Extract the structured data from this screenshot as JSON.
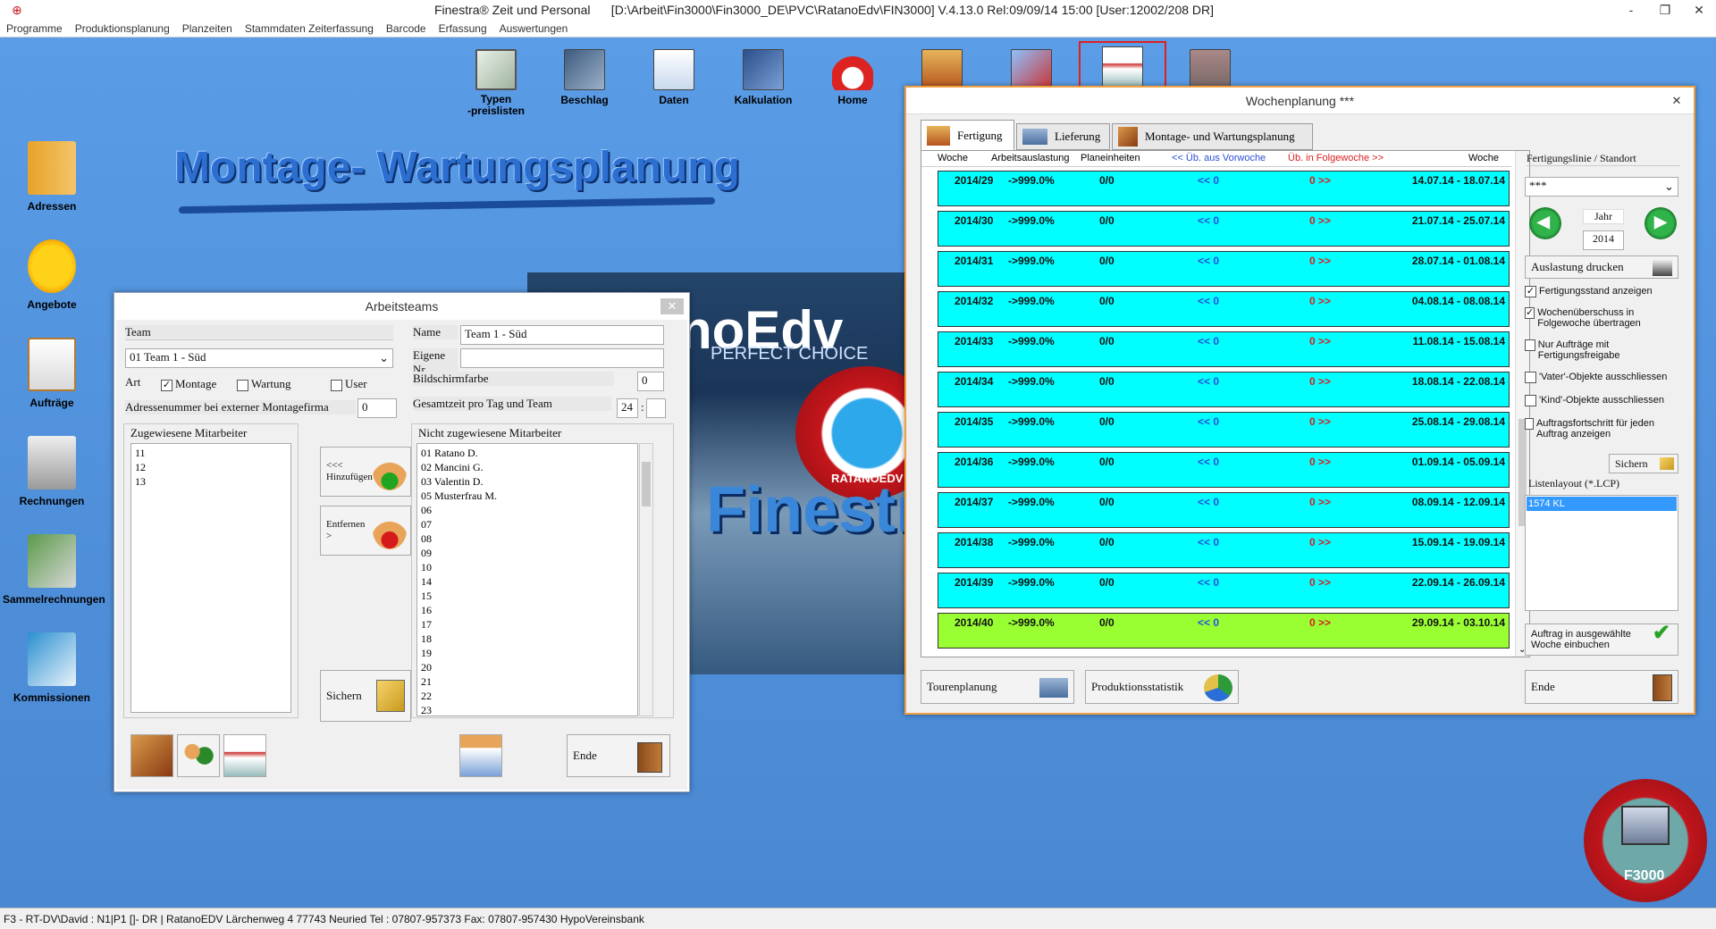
{
  "app": {
    "title": "Finestra® Zeit und Personal      [D:\\Arbeit\\Fin3000\\Fin3000_DE\\PVC\\RatanoEdv\\FIN3000] V.4.13.0 Rel:09/09/14 15:00 [User:12002/208 DR]",
    "window_controls": [
      "-",
      "❐",
      "✕"
    ]
  },
  "menu": [
    "Programme",
    "Produktionsplanung",
    "Planzeiten",
    "Stammdaten Zeiterfassung",
    "Barcode",
    "Erfassung",
    "Auswertungen"
  ],
  "toolbar": [
    {
      "label": "Typen\n-preislisten",
      "icon": "window-frame-icon"
    },
    {
      "label": "Beschlag",
      "icon": "fitting-icon"
    },
    {
      "label": "Daten",
      "icon": "data-icon"
    },
    {
      "label": "Kalkulation",
      "icon": "calculator-icon"
    },
    {
      "label": "Home",
      "icon": "home-icon"
    },
    {
      "label": "",
      "icon": "production-icon"
    },
    {
      "label": "",
      "icon": "chart-icon"
    },
    {
      "label": "",
      "icon": "planning-icon"
    },
    {
      "label": "",
      "icon": "factory-icon"
    }
  ],
  "left_icons": [
    {
      "label": "Adressen",
      "icon": "address-book-icon"
    },
    {
      "label": "Angebote",
      "icon": "sun-icon"
    },
    {
      "label": "Aufträge",
      "icon": "clipboard-icon"
    },
    {
      "label": "Rechnungen",
      "icon": "invoice-calculator-icon"
    },
    {
      "label": "Sammelrechnungen",
      "icon": "money-icon"
    },
    {
      "label": "Kommissionen",
      "icon": "document-arrow-icon"
    }
  ],
  "banner": "Montage- Wartungsplanung",
  "splash": {
    "logo": "noEdv",
    "tagline": "PERFECT CHOICE",
    "product": "Finestra",
    "seal": "RATANOEDV"
  },
  "arbeitsteams": {
    "title": "Arbeitsteams",
    "team_label": "Team",
    "team_value": "01 Team 1 - Süd",
    "name_label": "Name",
    "name_value": "Team 1 - Süd",
    "eigene_label": "Eigene Nr.",
    "eigene_value": "",
    "art_label": "Art",
    "art_options": [
      {
        "label": "Montage",
        "checked": true
      },
      {
        "label": "Wartung",
        "checked": false
      },
      {
        "label": "User",
        "checked": false
      }
    ],
    "farbe_label": "Bildschirmfarbe",
    "farbe_value": "0",
    "adressnr_label": "Adressenummer bei externer Montagefirma",
    "adressnr_value": "0",
    "gesamtzeit_label": "Gesamtzeit pro Tag und Team",
    "gesamtzeit_value": "24",
    "gesamtzeit_sep": ":",
    "gesamtzeit_min": "",
    "zugewiesen_label": "Zugewiesene Mitarbeiter",
    "zugewiesen": [
      "11",
      "12",
      "13"
    ],
    "nicht_label": "Nicht zugewiesene Mitarbeiter",
    "nicht": [
      "01 Ratano D.",
      "02 Mancini G.",
      "03 Valentin D.",
      "05 Musterfrau M.",
      "06",
      "07",
      "08",
      "09",
      "10",
      "14",
      "15",
      "16",
      "17",
      "18",
      "19",
      "20",
      "21",
      "22",
      "23"
    ],
    "hinzufuegen": "<<<\nHinzufügen",
    "entfernen": "Entfernen\n>",
    "sichern": "Sichern",
    "ende": "Ende"
  },
  "wochenplanung": {
    "title": "Wochenplanung ***",
    "tabs": [
      "Fertigung",
      "Lieferung",
      "Montage- und Wartungsplanung"
    ],
    "headers": [
      "Woche",
      "Arbeitsauslastung",
      "Planeinheiten",
      "<< Üb. aus Vorwoche",
      "Üb. in Folgewoche >>",
      "Woche"
    ],
    "rows": [
      {
        "woche": "2014/29",
        "auslastung": "->999.0%",
        "plan": "0/0",
        "vor": "<< 0",
        "folge": "0 >>",
        "range": "14.07.14 - 18.07.14",
        "color": "#00ffff"
      },
      {
        "woche": "2014/30",
        "auslastung": "->999.0%",
        "plan": "0/0",
        "vor": "<< 0",
        "folge": "0 >>",
        "range": "21.07.14 - 25.07.14",
        "color": "#00ffff"
      },
      {
        "woche": "2014/31",
        "auslastung": "->999.0%",
        "plan": "0/0",
        "vor": "<< 0",
        "folge": "0 >>",
        "range": "28.07.14 - 01.08.14",
        "color": "#00ffff"
      },
      {
        "woche": "2014/32",
        "auslastung": "->999.0%",
        "plan": "0/0",
        "vor": "<< 0",
        "folge": "0 >>",
        "range": "04.08.14 - 08.08.14",
        "color": "#00ffff"
      },
      {
        "woche": "2014/33",
        "auslastung": "->999.0%",
        "plan": "0/0",
        "vor": "<< 0",
        "folge": "0 >>",
        "range": "11.08.14 - 15.08.14",
        "color": "#00ffff"
      },
      {
        "woche": "2014/34",
        "auslastung": "->999.0%",
        "plan": "0/0",
        "vor": "<< 0",
        "folge": "0 >>",
        "range": "18.08.14 - 22.08.14",
        "color": "#00ffff"
      },
      {
        "woche": "2014/35",
        "auslastung": "->999.0%",
        "plan": "0/0",
        "vor": "<< 0",
        "folge": "0 >>",
        "range": "25.08.14 - 29.08.14",
        "color": "#00ffff"
      },
      {
        "woche": "2014/36",
        "auslastung": "->999.0%",
        "plan": "0/0",
        "vor": "<< 0",
        "folge": "0 >>",
        "range": "01.09.14 - 05.09.14",
        "color": "#00ffff"
      },
      {
        "woche": "2014/37",
        "auslastung": "->999.0%",
        "plan": "0/0",
        "vor": "<< 0",
        "folge": "0 >>",
        "range": "08.09.14 - 12.09.14",
        "color": "#00ffff"
      },
      {
        "woche": "2014/38",
        "auslastung": "->999.0%",
        "plan": "0/0",
        "vor": "<< 0",
        "folge": "0 >>",
        "range": "15.09.14 - 19.09.14",
        "color": "#00ffff"
      },
      {
        "woche": "2014/39",
        "auslastung": "->999.0%",
        "plan": "0/0",
        "vor": "<< 0",
        "folge": "0 >>",
        "range": "22.09.14 - 26.09.14",
        "color": "#00ffff"
      },
      {
        "woche": "2014/40",
        "auslastung": "->999.0%",
        "plan": "0/0",
        "vor": "<< 0",
        "folge": "0 >>",
        "range": "29.09.14 - 03.10.14",
        "color": "#99ff33"
      }
    ],
    "fertigungslinie_label": "Fertigungslinie / Standort",
    "fertigungslinie_value": "***",
    "jahr_label": "Jahr",
    "jahr_value": "2014",
    "auslastung_drucken": "Auslastung drucken",
    "checks": [
      {
        "label": "Fertigungsstand anzeigen",
        "checked": true
      },
      {
        "label": "Wochenüberschuss in Folgewoche übertragen",
        "checked": true
      },
      {
        "label": "Nur Aufträge mit Fertigungsfreigabe",
        "checked": false
      },
      {
        "label": "'Vater'-Objekte ausschliessen",
        "checked": false
      },
      {
        "label": "'Kind'-Objekte ausschliessen",
        "checked": false
      },
      {
        "label": "Auftragsfortschritt für jeden Auftrag anzeigen",
        "checked": false
      }
    ],
    "sichern": "Sichern",
    "listenlayout_label": "Listenlayout (*.LCP)",
    "listenlayout_value": "1574 KL",
    "einbuchen": "Auftrag in ausgewählte Woche einbuchen",
    "tourenplanung": "Tourenplanung",
    "produktionsstatistik": "Produktionsstatistik",
    "ende": "Ende"
  },
  "status": "F3 - RT-DV\\David : N1|P1 []- DR | RatanoEDV Lärchenweg 4  77743 Neuried  Tel : 07807-957373 Fax: 07807-957430  HypoVereinsbank",
  "badge": "F3000",
  "colors": {
    "desktop": "#4e8fde",
    "row_cyan": "#00ffff",
    "row_green": "#99ff33",
    "accent_red": "#c4161c"
  }
}
